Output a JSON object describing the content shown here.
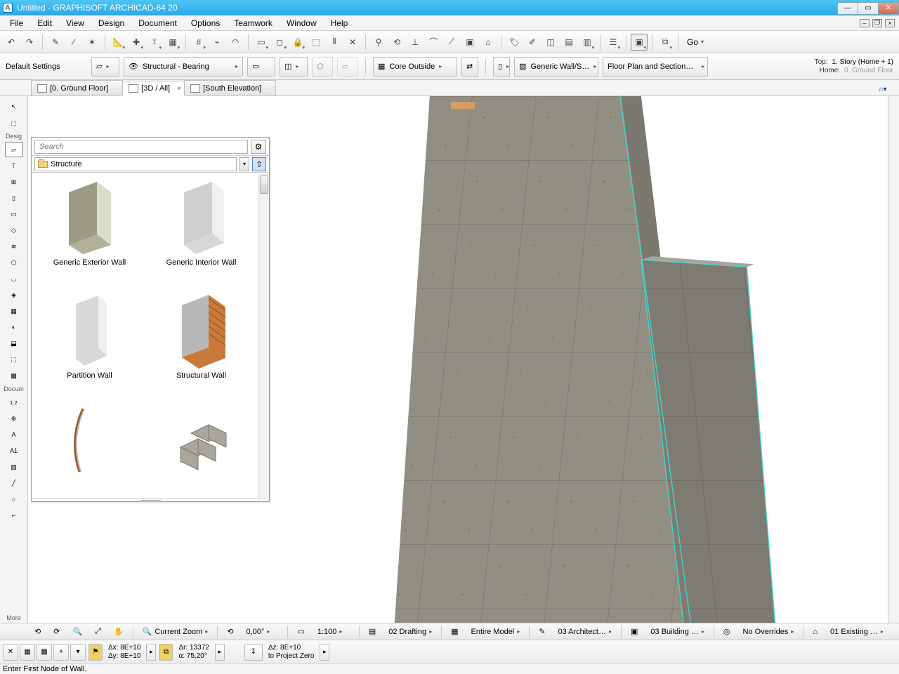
{
  "titlebar": {
    "title": "Untitled - GRAPHISOFT ARCHICAD-64 20"
  },
  "menu": [
    "File",
    "Edit",
    "View",
    "Design",
    "Document",
    "Options",
    "Teamwork",
    "Window",
    "Help"
  ],
  "go_label": "Go",
  "optbar": {
    "default": "Default Settings",
    "layer": "Structural - Bearing",
    "comp": "Core Outside",
    "bm": "Generic Wall/S…",
    "fcd": "Floor Plan and Section…",
    "top_label": "Top:",
    "top_val": "1. Story (Home + 1)",
    "home_label": "Home:",
    "home_val": "0. Ground Floor"
  },
  "tabs": {
    "t0": "[0. Ground Floor]",
    "t1": "[3D / All]",
    "t2": "[South Elevation]"
  },
  "toolbox": {
    "head0": "Desig",
    "head1": "Docum",
    "more": "More"
  },
  "fav": {
    "search_ph": "Search",
    "folder": "Structure",
    "items": {
      "i0": "Generic Exterior Wall",
      "i1": "Generic Interior Wall",
      "i2": "Partition Wall",
      "i3": "Structural Wall"
    }
  },
  "zoombar": {
    "currentzoom": "Current Zoom",
    "angle": "0,00°",
    "scale": "1:100",
    "layers": "02 Drafting",
    "model": "Entire Model",
    "pen": "03 Architect…",
    "mvo": "03 Building …",
    "ovr": "No Overrides",
    "reno": "01 Existing …"
  },
  "coords": {
    "dx": "Δx: 8E+10",
    "dy": "Δy: 8E+10",
    "dr": "Δr: 13372",
    "da": "α: 75,20°",
    "dz": "Δz: 8E+10",
    "proj": "to Project Zero"
  },
  "hint": "Enter First Node of Wall."
}
